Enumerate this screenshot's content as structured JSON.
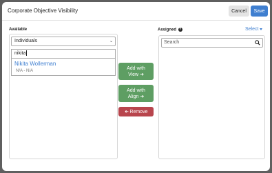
{
  "modal": {
    "title": "Corporate Objective Visibility",
    "cancel_label": "Cancel",
    "save_label": "Save"
  },
  "available": {
    "label": "Available",
    "type_select": "Individuals",
    "filter_value": "nikita",
    "results": [
      {
        "name": "Nikita Wollerman",
        "sub": "N/A - N/A"
      }
    ]
  },
  "actions": {
    "add_view_line1": "Add with",
    "add_view_line2": "View",
    "add_align_line1": "Add with",
    "add_align_line2": "Align",
    "remove_label": "Remove"
  },
  "assigned": {
    "label": "Assigned",
    "select_label": "Select",
    "search_placeholder": "Search"
  },
  "colors": {
    "primary": "#3f7fd0",
    "success": "#5e9e63",
    "danger": "#b8454d"
  }
}
